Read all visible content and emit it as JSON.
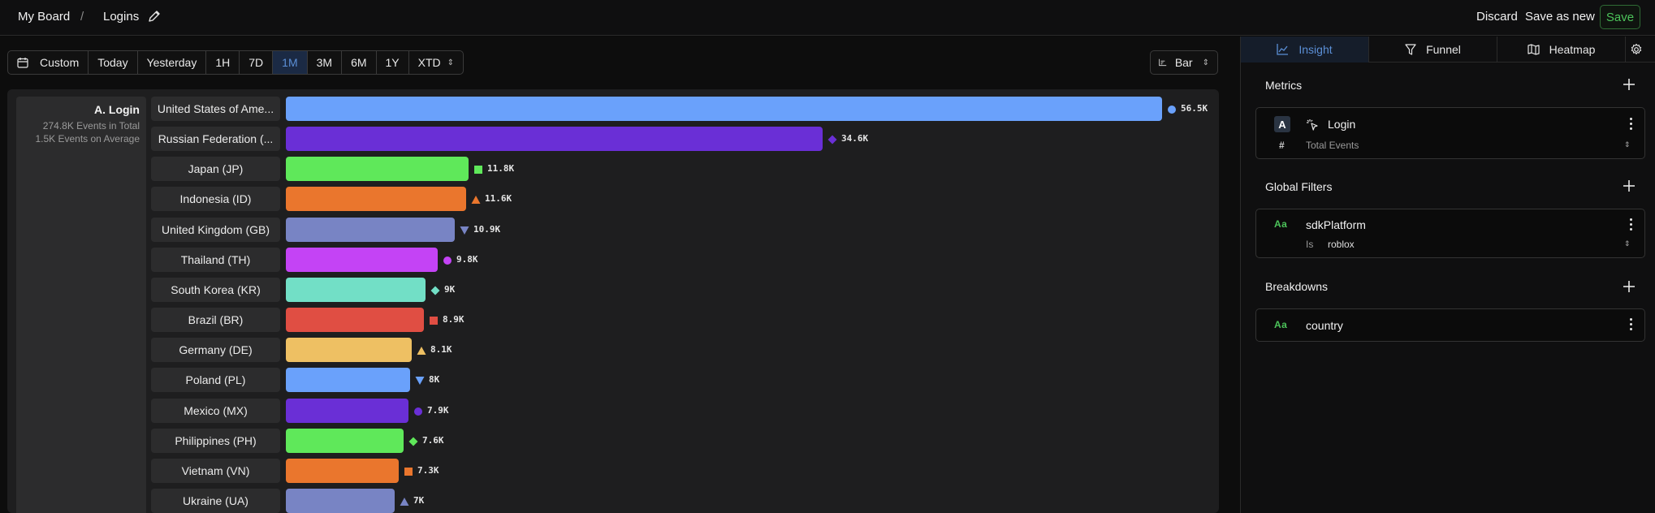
{
  "breadcrumb": {
    "board": "My Board",
    "separator": "/",
    "name": "Logins"
  },
  "actions": {
    "discard": "Discard",
    "save_as_new": "Save as new",
    "save": "Save"
  },
  "time_range": {
    "options": [
      "Custom",
      "Today",
      "Yesterday",
      "1H",
      "7D",
      "1M",
      "3M",
      "6M",
      "1Y",
      "XTD"
    ],
    "selected": "1M"
  },
  "chart_type": {
    "label": "Bar"
  },
  "series": {
    "title": "A. Login",
    "total": "274.8K Events in Total",
    "average": "1.5K Events on Average"
  },
  "chart_data": {
    "type": "bar",
    "orientation": "horizontal",
    "categories": [
      "United States of Ame...",
      "Russian Federation (...",
      "Japan (JP)",
      "Indonesia (ID)",
      "United Kingdom (GB)",
      "Thailand (TH)",
      "South Korea (KR)",
      "Brazil (BR)",
      "Germany (DE)",
      "Poland (PL)",
      "Mexico (MX)",
      "Philippines (PH)",
      "Vietnam (VN)",
      "Ukraine (UA)"
    ],
    "values": [
      56500,
      34600,
      11800,
      11600,
      10900,
      9800,
      9000,
      8900,
      8100,
      8000,
      7900,
      7600,
      7300,
      7000
    ],
    "value_labels": [
      "56.5K",
      "34.6K",
      "11.8K",
      "11.6K",
      "10.9K",
      "9.8K",
      "9K",
      "8.9K",
      "8.1K",
      "8K",
      "7.9K",
      "7.6K",
      "7.3K",
      "7K"
    ],
    "colors": [
      "#6aa1fb",
      "#6a2fd6",
      "#5fe85a",
      "#ea762d",
      "#7884c4",
      "#c443f5",
      "#72dfc6",
      "#e04e43",
      "#eec063",
      "#6aa1fb",
      "#6a2fd6",
      "#5fe85a",
      "#ea762d",
      "#7884c4"
    ],
    "markers": [
      "circle",
      "diamond",
      "square",
      "triangle",
      "triangle-down",
      "circle",
      "diamond",
      "square",
      "triangle",
      "triangle-down",
      "circle",
      "diamond",
      "square",
      "triangle"
    ]
  },
  "panel": {
    "tabs": [
      {
        "label": "Insight",
        "icon": "chart-icon"
      },
      {
        "label": "Funnel",
        "icon": "funnel-icon"
      },
      {
        "label": "Heatmap",
        "icon": "map-icon"
      }
    ],
    "active_tab": "Insight",
    "metrics": {
      "heading": "Metrics",
      "items": [
        {
          "badge": "A",
          "event": "Login",
          "aggregation_symbol": "#",
          "aggregation": "Total Events"
        }
      ]
    },
    "global_filters": {
      "heading": "Global Filters",
      "items": [
        {
          "type_icon": "Aa",
          "property": "sdkPlatform",
          "operator": "Is",
          "value": "roblox"
        }
      ]
    },
    "breakdowns": {
      "heading": "Breakdowns",
      "items": [
        {
          "type_icon": "Aa",
          "property": "country"
        }
      ]
    }
  },
  "colors": {
    "accent": "#5b8fd6",
    "save_green": "#4cc35a"
  }
}
